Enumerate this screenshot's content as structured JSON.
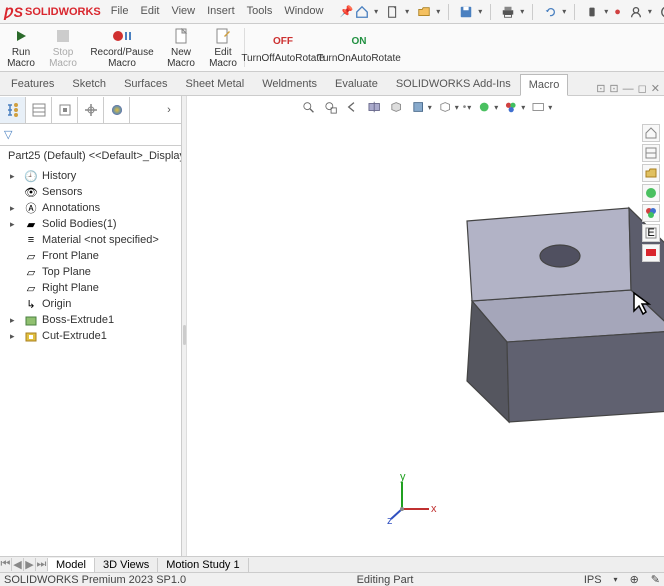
{
  "app": {
    "name": "SOLIDWORKS"
  },
  "menu": {
    "file": "File",
    "edit": "Edit",
    "view": "View",
    "insert": "Insert",
    "tools": "Tools",
    "window": "Window"
  },
  "ribbon": {
    "run_macro": "Run\nMacro",
    "stop_macro": "Stop\nMacro",
    "record_pause": "Record/Pause\nMacro",
    "new_macro": "New\nMacro",
    "edit_macro": "Edit\nMacro",
    "turn_off_autorotate": "TurnOffAutoRotate",
    "turn_on_autorotate": "TurnOnAutoRotate",
    "off": "OFF",
    "on": "ON"
  },
  "tabs": {
    "features": "Features",
    "sketch": "Sketch",
    "surfaces": "Surfaces",
    "sheet_metal": "Sheet Metal",
    "weldments": "Weldments",
    "evaluate": "Evaluate",
    "add_ins": "SOLIDWORKS Add-Ins",
    "macro": "Macro"
  },
  "part": {
    "title": "Part25 (Default) <<Default>_Display Stat"
  },
  "tree": {
    "history": "History",
    "sensors": "Sensors",
    "annotations": "Annotations",
    "solid_bodies": "Solid Bodies(1)",
    "material": "Material <not specified>",
    "front_plane": "Front Plane",
    "top_plane": "Top Plane",
    "right_plane": "Right Plane",
    "origin": "Origin",
    "boss_extrude": "Boss-Extrude1",
    "cut_extrude": "Cut-Extrude1"
  },
  "bottom": {
    "model": "Model",
    "views_3d": "3D Views",
    "motion_study": "Motion Study 1"
  },
  "status": {
    "product": "SOLIDWORKS Premium 2023 SP1.0",
    "mode": "Editing Part",
    "units": "IPS"
  },
  "triad": {
    "x": "x",
    "y": "y",
    "z": "z"
  }
}
